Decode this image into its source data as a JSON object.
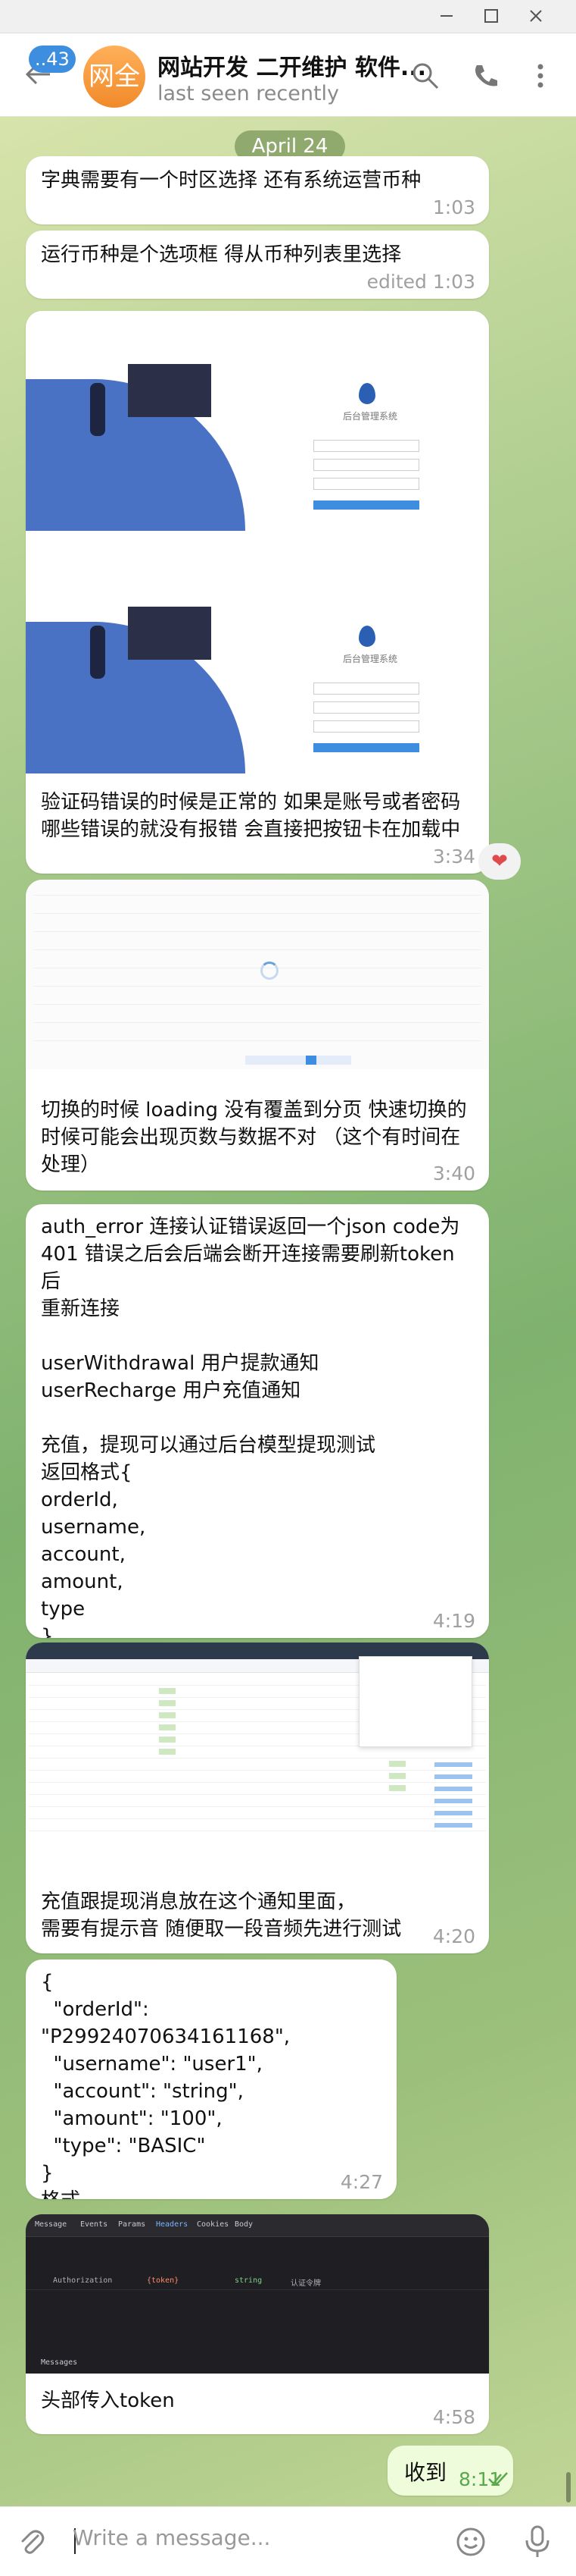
{
  "window": {
    "minimize_icon": "minimize-icon",
    "maximize_icon": "maximize-icon",
    "close_icon": "close-icon"
  },
  "header": {
    "unread_count": "..43",
    "avatar_text": "网全",
    "title": "网站开发 二开维护 软件...",
    "status": "last seen recently",
    "icons": [
      "search-icon",
      "phone-icon",
      "more-icon"
    ]
  },
  "date_label": "April 24",
  "messages": [
    {
      "text": "字典需要有一个时区选择 还有系统运营币种",
      "time": "1:03"
    },
    {
      "text": "运行币种是个选项框 得从币种列表里选择",
      "time": "edited 1:03"
    },
    {
      "text": "验证码错误的时候是正常的 如果是账号或者密码\n哪些错误的就没有报错 会直接把按钮卡在加载中",
      "time": "3:34",
      "reaction": "❤",
      "image_caption": "后台管理系统"
    },
    {
      "text": "切换的时候 loading 没有覆盖到分页 快速切换的\n时候可能会出现页数与数据不对 （这个有时间在\n处理）",
      "time": "3:40"
    },
    {
      "text": "auth_error 连接认证错误返回一个json code为\n401 错误之后会后端会断开连接需要刷新token后\n重新连接\n\nuserWithdrawal 用户提款通知\nuserRecharge 用户充值通知\n\n充值，提现可以通过后台模型提现测试\n返回格式{\norderId,\nusername,\naccount,\namount,\ntype\n}",
      "time": "4:19"
    },
    {
      "text": "充值跟提现消息放在这个通知里面，\n需要有提示音 随便取一段音频先进行测试",
      "time": "4:20"
    },
    {
      "text": "{\n  \"orderId\": \"P29924070634161168\",\n  \"username\": \"user1\",\n  \"account\": \"string\",\n  \"amount\": \"100\",\n  \"type\": \"BASIC\"\n}\n格式",
      "time": "4:27"
    },
    {
      "text": "头部传入token",
      "time": "4:58",
      "devtools": {
        "tabs": [
          "Message",
          "Events",
          "Params",
          "Headers",
          "Cookies",
          "Body"
        ],
        "header_name": "Authorization",
        "header_value": "{token}",
        "header_type": "string",
        "header_desc": "认证令牌",
        "footer": "Messages"
      }
    }
  ],
  "outgoing": {
    "text": "收到",
    "time": "8:11"
  },
  "composer": {
    "placeholder": "Write a message...",
    "icons": [
      "attach-icon",
      "emoji-icon",
      "mic-icon"
    ]
  }
}
